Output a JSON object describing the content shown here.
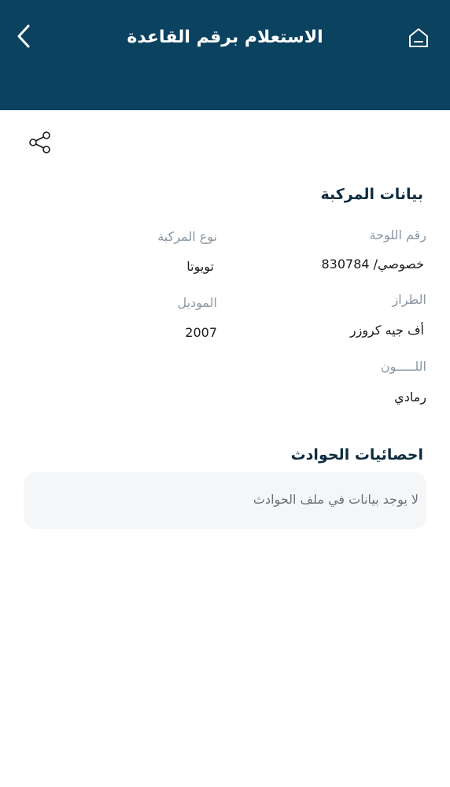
{
  "header": {
    "title": "الاستعلام برقم القاعدة",
    "back_icon": "chevron-left-icon",
    "home_icon": "home-icon"
  },
  "share_icon": "share-icon",
  "vehicle": {
    "title": "بيانات المركبة",
    "plate_label": "رقم اللوحة",
    "plate_value": "خصوصي/ 830784",
    "type_label": "نوع المركبة",
    "type_value": "تويوتا",
    "style_label": "الطراز",
    "style_value": "أف جيه كروزر",
    "model_label": "الموديل",
    "model_value": "2007",
    "color_label": "اللـــــون",
    "color_value": "رمادي"
  },
  "accidents": {
    "title": "احصائيات الحوادث",
    "empty_text": "لا يوجد بيانات  في ملف الحوادث"
  },
  "colors": {
    "header_bg": "#0b4260",
    "title_text": "#0d2c3f",
    "label_text": "#8a97a3",
    "box_bg": "#f5f6f8"
  }
}
